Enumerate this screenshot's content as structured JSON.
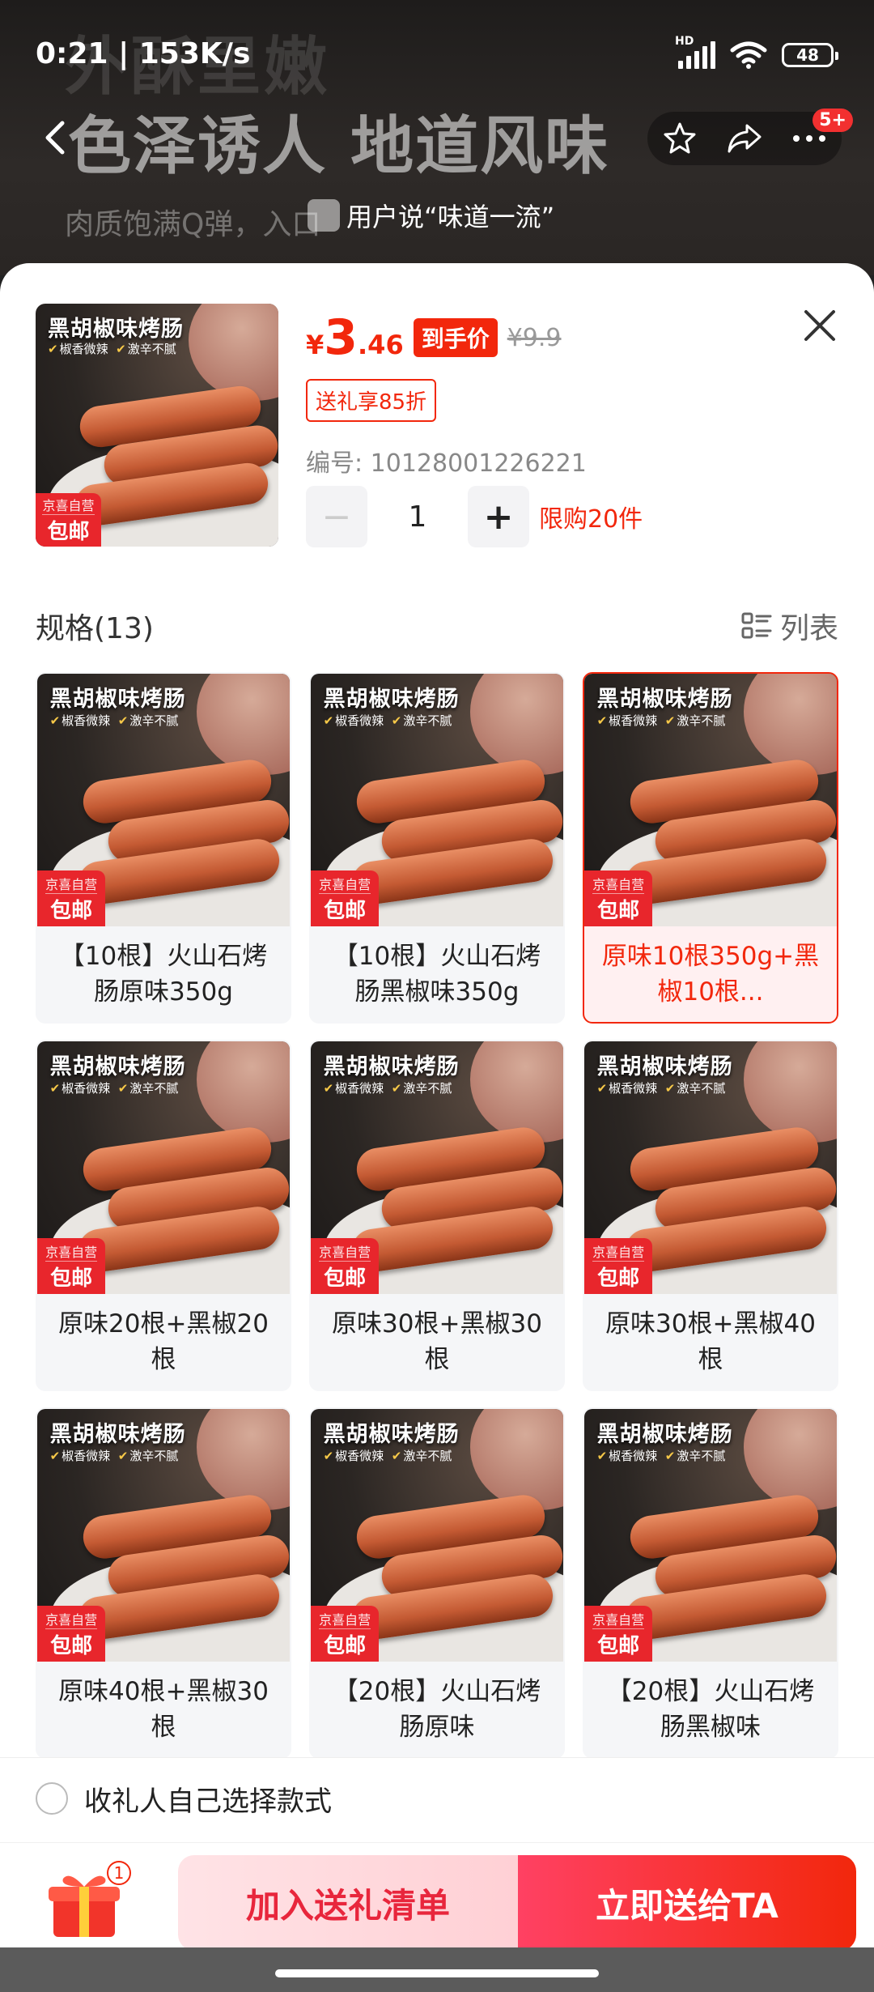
{
  "background": {
    "headline_1": "外酥里嫩",
    "headline_2": "色泽诱人 地道风味",
    "subline": "肉质饱满Q弹，入口",
    "review": "用户说“味道一流”"
  },
  "status_bar": {
    "time_speed": "0:21 | 153K/s",
    "network": "HD",
    "battery": "48"
  },
  "nav": {
    "more_badge": "5+"
  },
  "product": {
    "image_title": "黑胡椒味烤肠",
    "image_tag_1": "椒香微辣",
    "image_tag_2": "激辛不腻",
    "badge_top": "京喜自营",
    "badge_bottom": "包邮",
    "price_symbol": "¥",
    "price_int": "3",
    "price_dec": ".46",
    "deal_label": "到手价",
    "original_price": "¥9.9",
    "gift_discount": "送礼享85折",
    "sku_number": "编号: 10128001226221",
    "quantity": "1",
    "qty_minus": "−",
    "qty_plus": "+",
    "limit_text": "限购20件"
  },
  "spec": {
    "title": "规格(13)",
    "list_label": "列表",
    "options": [
      {
        "label": "【10根】火山石烤肠原味350g",
        "selected": false
      },
      {
        "label": "【10根】火山石烤肠黑椒味350g",
        "selected": false
      },
      {
        "label": "原味10根350g+黑椒10根...",
        "selected": true
      },
      {
        "label": "原味20根+黑椒20根",
        "selected": false
      },
      {
        "label": "原味30根+黑椒30根",
        "selected": false
      },
      {
        "label": "原味30根+黑椒40根",
        "selected": false
      },
      {
        "label": "原味40根+黑椒30根",
        "selected": false
      },
      {
        "label": "【20根】火山石烤肠原味",
        "selected": false
      },
      {
        "label": "【20根】火山石烤肠黑椒味",
        "selected": false
      }
    ]
  },
  "receiver_choice": {
    "label": "收礼人自己选择款式",
    "checked": false
  },
  "bottom_bar": {
    "gift_count": "1",
    "add_button": "加入送礼清单",
    "send_button": "立即送给TA"
  },
  "colors": {
    "accent": "#f2270c",
    "selected_bg": "#fff0f1"
  }
}
